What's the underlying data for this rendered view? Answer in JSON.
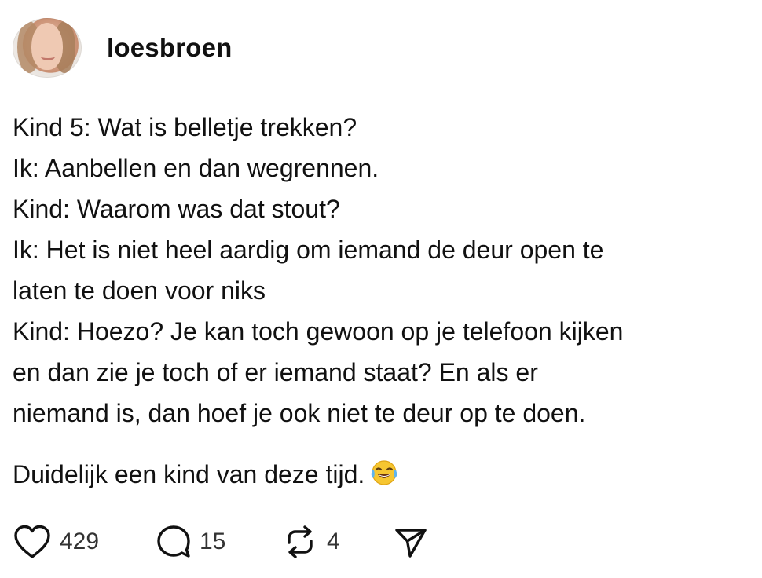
{
  "post": {
    "username": "loesbroen",
    "lines": [
      "Kind 5: Wat is belletje trekken?",
      "Ik: Aanbellen en dan wegrennen.",
      "Kind: Waarom was dat stout?",
      "Ik: Het is niet heel aardig om iemand de deur open te",
      "laten te doen voor niks",
      "Kind: Hoezo? Je kan toch gewoon op je telefoon kijken",
      "en dan zie je toch of er iemand staat? En als er",
      "niemand is, dan hoef je ook niet te deur op te doen."
    ],
    "closing_line": "Duidelijk een kind van deze tijd.",
    "closing_emoji": "tears-of-joy-emoji"
  },
  "actions": {
    "likes": "429",
    "replies": "15",
    "reposts": "4"
  },
  "icons": {
    "like": "heart-icon",
    "reply": "speech-bubble-icon",
    "repost": "repost-arrows-icon",
    "share": "send-arrow-icon"
  },
  "colors": {
    "text": "#111111",
    "icon": "#111111",
    "count": "#333333",
    "background": "#ffffff"
  }
}
